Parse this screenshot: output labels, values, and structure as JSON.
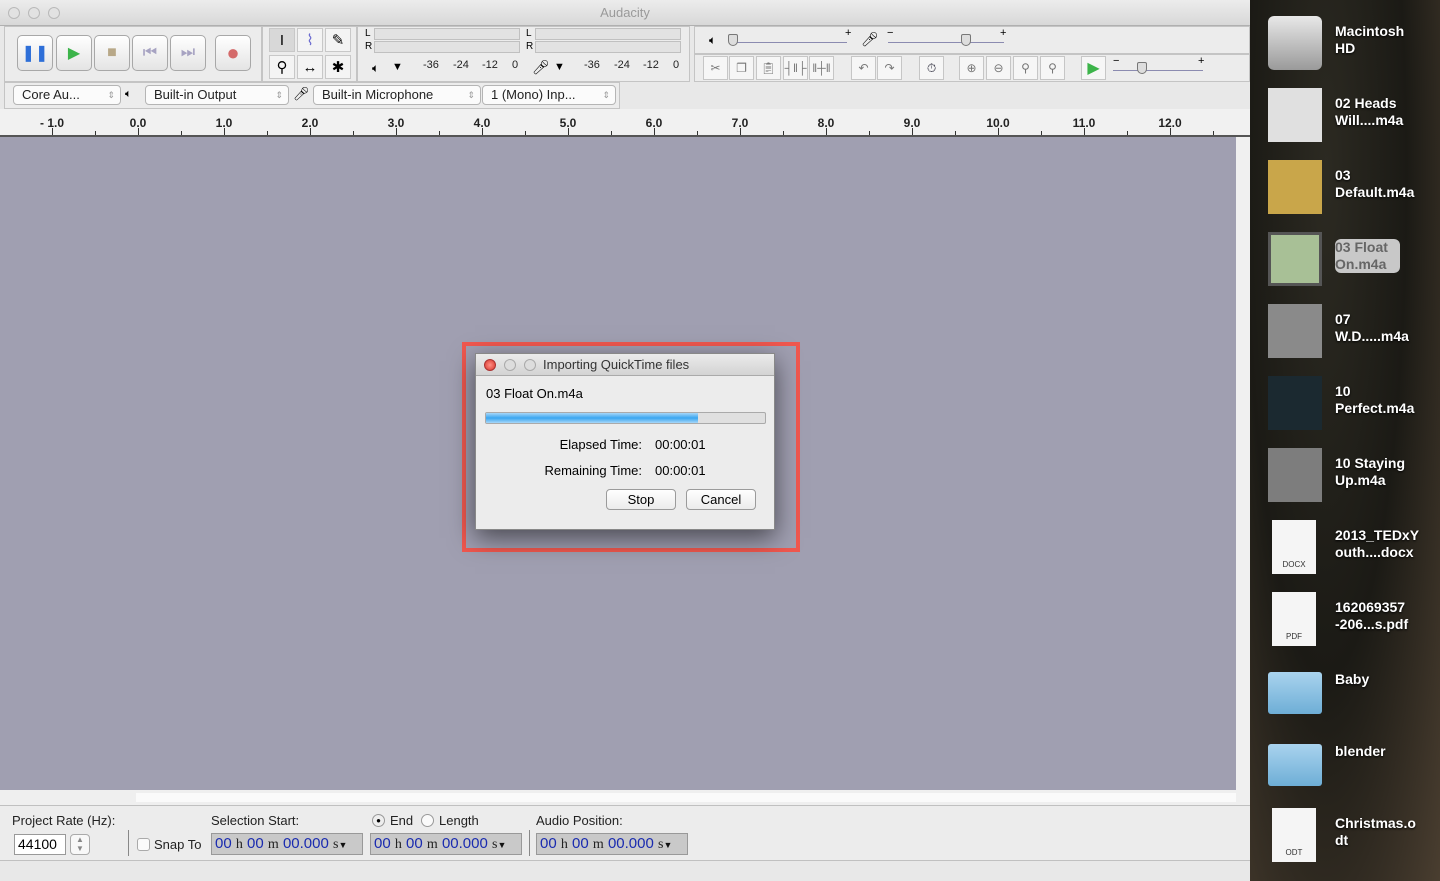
{
  "window": {
    "title": "Audacity"
  },
  "transport": {
    "buttons": [
      "pause",
      "play",
      "stop",
      "skip-to-start",
      "skip-to-end",
      "record"
    ]
  },
  "meters": {
    "scale": [
      "-36",
      "-24",
      "-12",
      "0"
    ],
    "channels": [
      "L",
      "R"
    ]
  },
  "device": {
    "host": "Core Au...",
    "output": "Built-in Output",
    "input": "Built-in Microphone",
    "channels": "1 (Mono) Inp..."
  },
  "sliders": {
    "minus": "−",
    "plus": "+",
    "output_volume": 0.0,
    "input_volume": 0.65,
    "play_speed": 0.3
  },
  "ruler": {
    "labels": [
      "- 1.0",
      "0.0",
      "1.0",
      "2.0",
      "3.0",
      "4.0",
      "5.0",
      "6.0",
      "7.0",
      "8.0",
      "9.0",
      "10.0",
      "11.0",
      "12.0"
    ],
    "values": [
      -1,
      0,
      1,
      2,
      3,
      4,
      5,
      6,
      7,
      8,
      9,
      10,
      11,
      12
    ]
  },
  "bottom": {
    "project_rate_label": "Project Rate (Hz):",
    "project_rate": "44100",
    "snap_to": "Snap To",
    "selection_start_label": "Selection Start:",
    "end_label": "End",
    "length_label": "Length",
    "audio_position_label": "Audio Position:",
    "end_selected": true,
    "time_parts": {
      "h": "00",
      "hu": "h",
      "m": "00",
      "mu": "m",
      "s": "00.000",
      "su": "s"
    }
  },
  "dialog": {
    "title": "Importing QuickTime files",
    "file": "03 Float On.m4a",
    "progress": 0.76,
    "elapsed_label": "Elapsed Time:",
    "elapsed": "00:00:01",
    "remaining_label": "Remaining Time:",
    "remaining": "00:00:01",
    "stop": "Stop",
    "cancel": "Cancel",
    "highlight_color": "#f0584f"
  },
  "desktop": {
    "items": [
      {
        "label": "Macintosh\nHD",
        "icon": "hard-drive"
      },
      {
        "label": "02 Heads\nWill....m4a",
        "icon": "album-art"
      },
      {
        "label": "03\nDefault.m4a",
        "icon": "album-art"
      },
      {
        "label": "03 Float\nOn.m4a",
        "icon": "album-art",
        "selected": true
      },
      {
        "label": "07\nW.D.....m4a",
        "icon": "album-art"
      },
      {
        "label": "10\nPerfect.m4a",
        "icon": "album-art"
      },
      {
        "label": "10 Staying\nUp.m4a",
        "icon": "album-art"
      },
      {
        "label": "2013_TEDxY\nouth....docx",
        "icon": "document",
        "badge": "DOCX"
      },
      {
        "label": "162069357\n-206...s.pdf",
        "icon": "document",
        "badge": "PDF"
      },
      {
        "label": "Baby",
        "icon": "folder"
      },
      {
        "label": "blender",
        "icon": "folder"
      },
      {
        "label": "Christmas.o\ndt",
        "icon": "document",
        "badge": "ODT"
      }
    ]
  }
}
